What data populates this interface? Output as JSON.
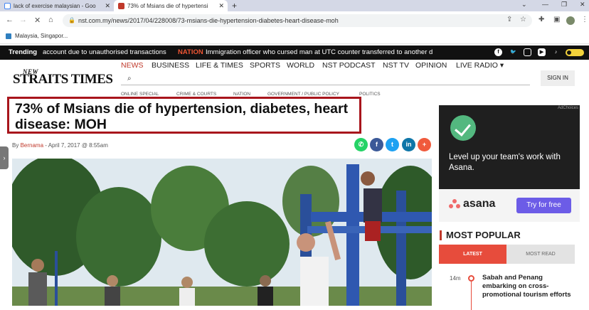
{
  "browser": {
    "tabs": [
      {
        "title": "lack of exercise malaysian - Goo"
      },
      {
        "title": "73% of Msians die of hypertensi"
      }
    ],
    "url": "nst.com.my/news/2017/04/228008/73-msians-die-hypertension-diabetes-heart-disease-moh",
    "bookmark": "Malaysia, Singapor..."
  },
  "trending": {
    "label": "Trending",
    "item1": "account due to unauthorised transactions",
    "category": "NATION",
    "item2": "Immigration officer who cursed man at UTC counter transferred to another d"
  },
  "site": {
    "logo_small": "NEW",
    "logo_main": "STRAITS TIMES",
    "nav": [
      "NEWS",
      "BUSINESS",
      "LIFE & TIMES",
      "SPORTS",
      "WORLD",
      "NST PODCAST",
      "NST TV",
      "OPINION",
      "LIVE RADIO ▾"
    ],
    "subnav": [
      "ONLINE SPECIAL",
      "CRIME & COURTS",
      "NATION",
      "GOVERNMENT / PUBLIC POLICY",
      "POLITICS"
    ],
    "signin": "SIGN IN"
  },
  "article": {
    "headline": "73% of Msians die of hypertension, diabetes, heart disease: MOH",
    "by": "By ",
    "author": "Bernama",
    "date": " - April 7, 2017 @ 8:55am"
  },
  "ad": {
    "tag": "AdChoices",
    "copy": "Level up your team's work with Asana.",
    "brand": "asana",
    "cta": "Try for free"
  },
  "most_popular": {
    "title": "MOST POPULAR",
    "tab_latest": "LATEST",
    "tab_mostread": "MOST READ",
    "item_time": "14m",
    "item_text": "Sabah and Penang embarking on cross-promotional tourism efforts"
  }
}
